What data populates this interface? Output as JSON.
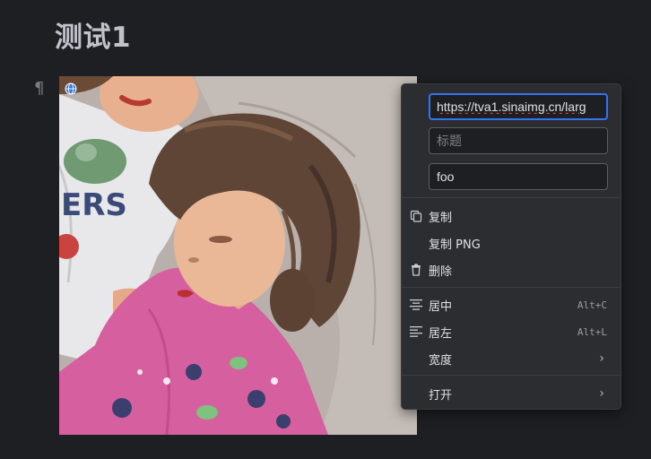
{
  "document": {
    "title": "测试1",
    "paragraph_marker": "¶"
  },
  "image": {
    "globe_icon": "globe-icon"
  },
  "context_menu": {
    "url_input": {
      "value": "https://tva1.sinaimg.cn/larg"
    },
    "title_input": {
      "placeholder": "标题",
      "value": ""
    },
    "alt_input": {
      "value": "foo"
    },
    "items": {
      "copy": {
        "label": "复制",
        "icon": "copy-icon"
      },
      "copy_png": {
        "label": "复制 PNG"
      },
      "delete": {
        "label": "删除",
        "icon": "trash-icon"
      },
      "align_center": {
        "label": "居中",
        "shortcut": "Alt+C",
        "icon": "align-center-icon"
      },
      "align_left": {
        "label": "居左",
        "shortcut": "Alt+L",
        "icon": "align-left-icon"
      },
      "width": {
        "label": "宽度",
        "submenu": "›"
      },
      "open": {
        "label": "打开",
        "submenu": "›"
      }
    }
  }
}
